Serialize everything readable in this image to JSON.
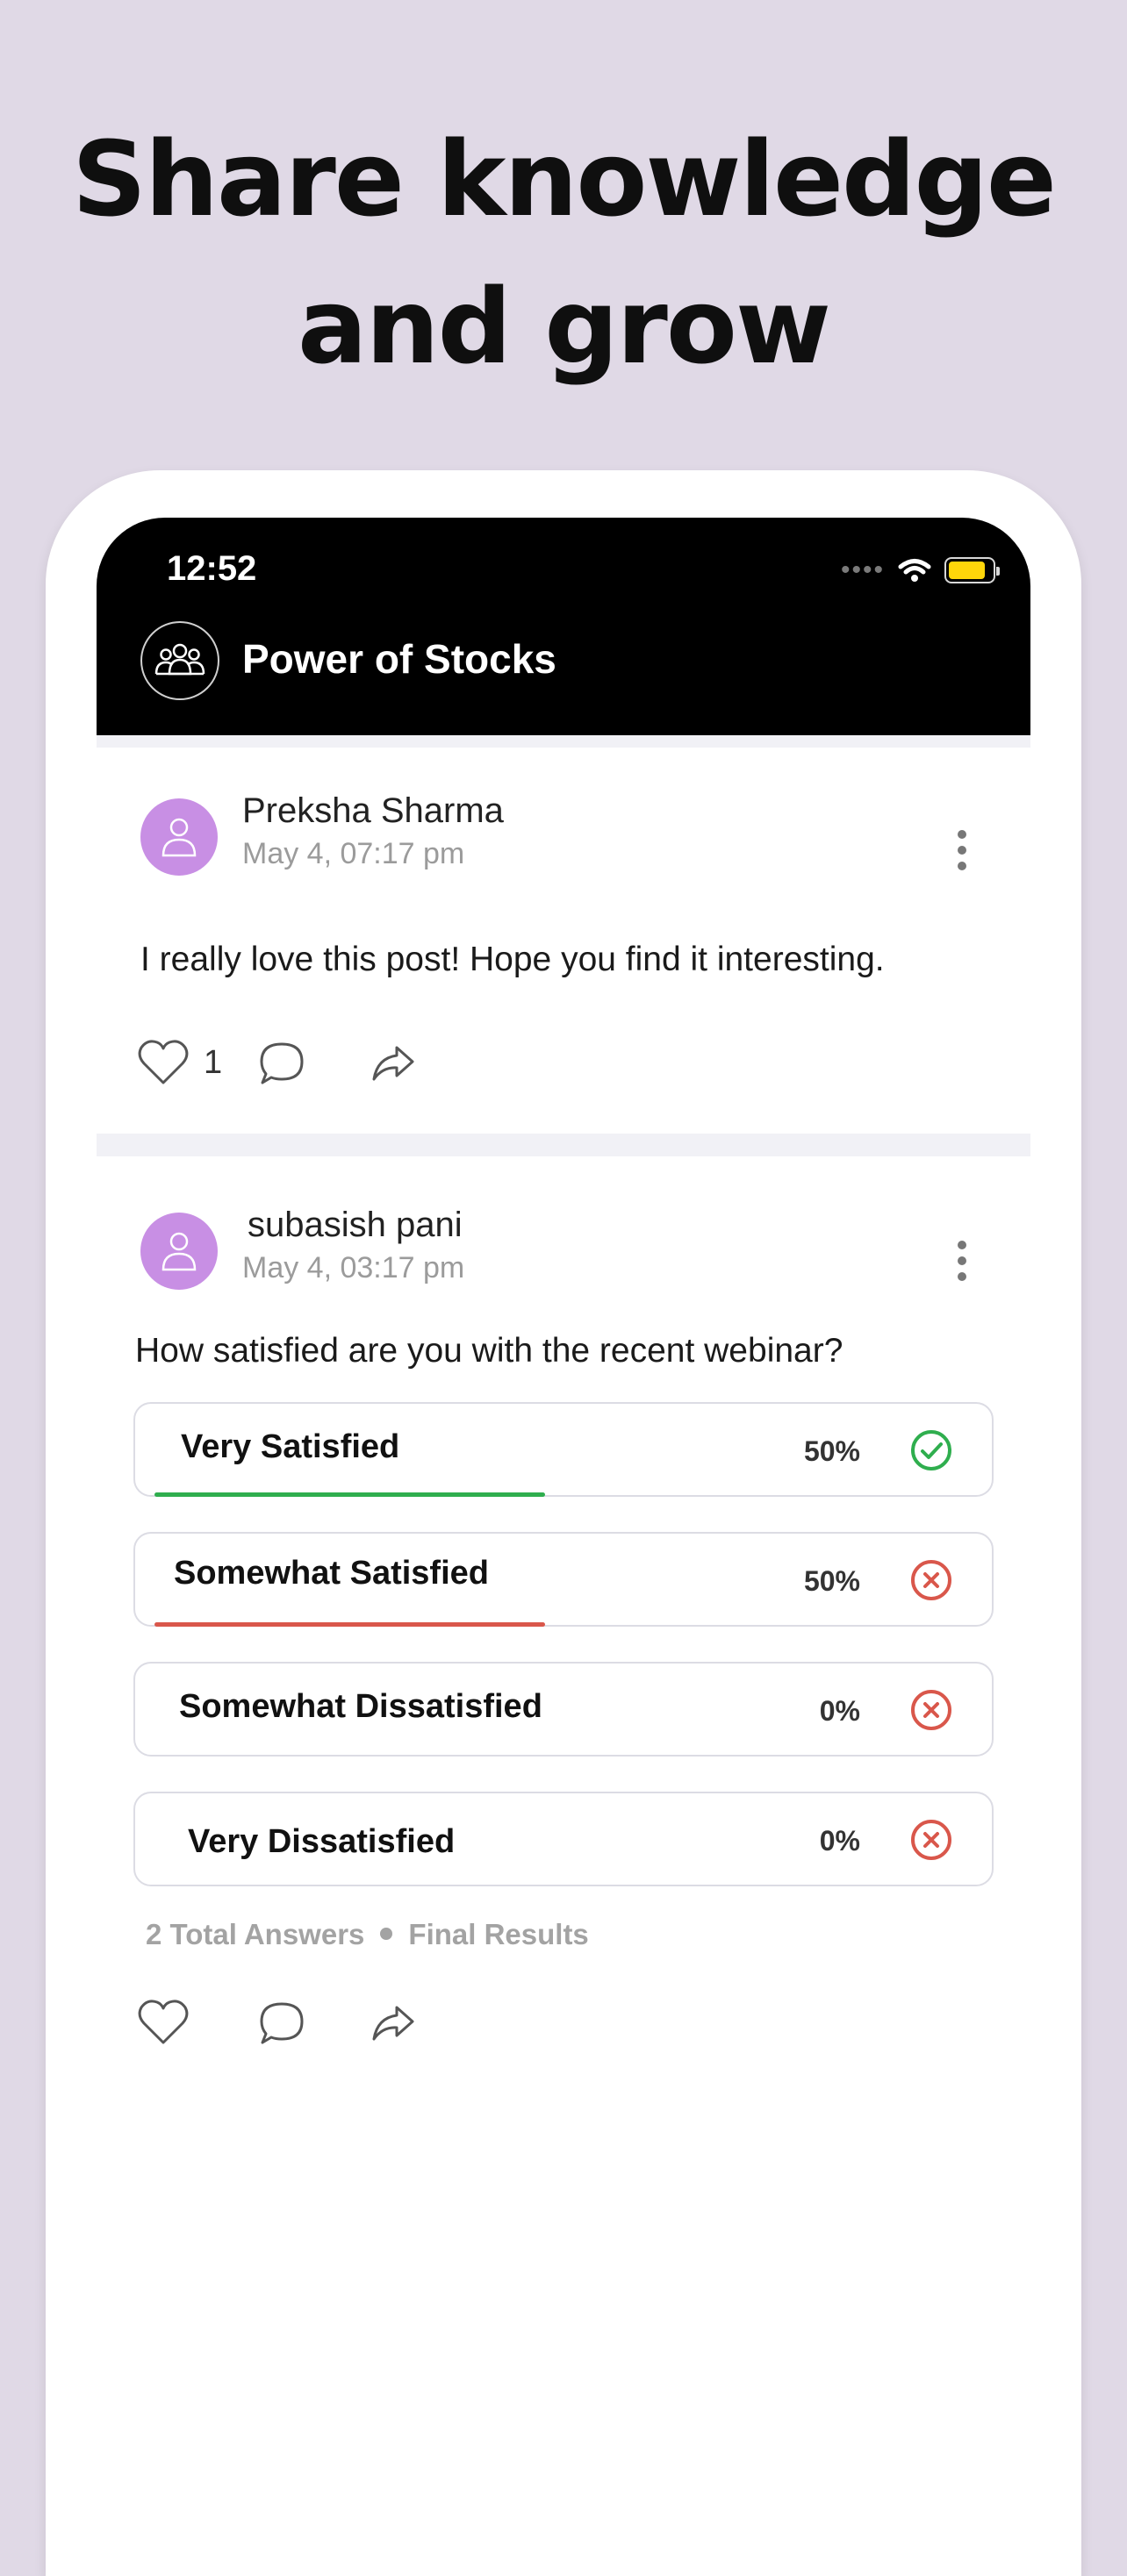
{
  "headline": {
    "line1": "Share knowledge",
    "line2": "and grow"
  },
  "status_bar": {
    "time": "12:52"
  },
  "header": {
    "title": "Power of Stocks",
    "avatar_icon": "group-icon"
  },
  "posts": [
    {
      "author": "Preksha Sharma",
      "date": "May 4, 07:17 pm",
      "text": "I really love this post! Hope you find it interesting.",
      "like_count": "1"
    },
    {
      "author": "subasish pani",
      "date": "May 4, 03:17 pm",
      "question": "How satisfied are you with the recent webinar?",
      "options": [
        {
          "label": "Very Satisfied",
          "percent": "50%",
          "fraction": 0.5,
          "status": "correct"
        },
        {
          "label": "Somewhat Satisfied",
          "percent": "50%",
          "fraction": 0.5,
          "status": "incorrect"
        },
        {
          "label": "Somewhat Dissatisfied",
          "percent": "0%",
          "fraction": 0,
          "status": "incorrect"
        },
        {
          "label": "Very Dissatisfied",
          "percent": "0%",
          "fraction": 0,
          "status": "incorrect"
        }
      ],
      "total_answers": "2 Total Answers",
      "result_state": "Final Results"
    }
  ],
  "colors": {
    "background": "#e0d9e6",
    "avatar": "#c88fe4",
    "correct": "#2fae4e",
    "incorrect": "#d9574b",
    "battery": "#ffd60a"
  }
}
